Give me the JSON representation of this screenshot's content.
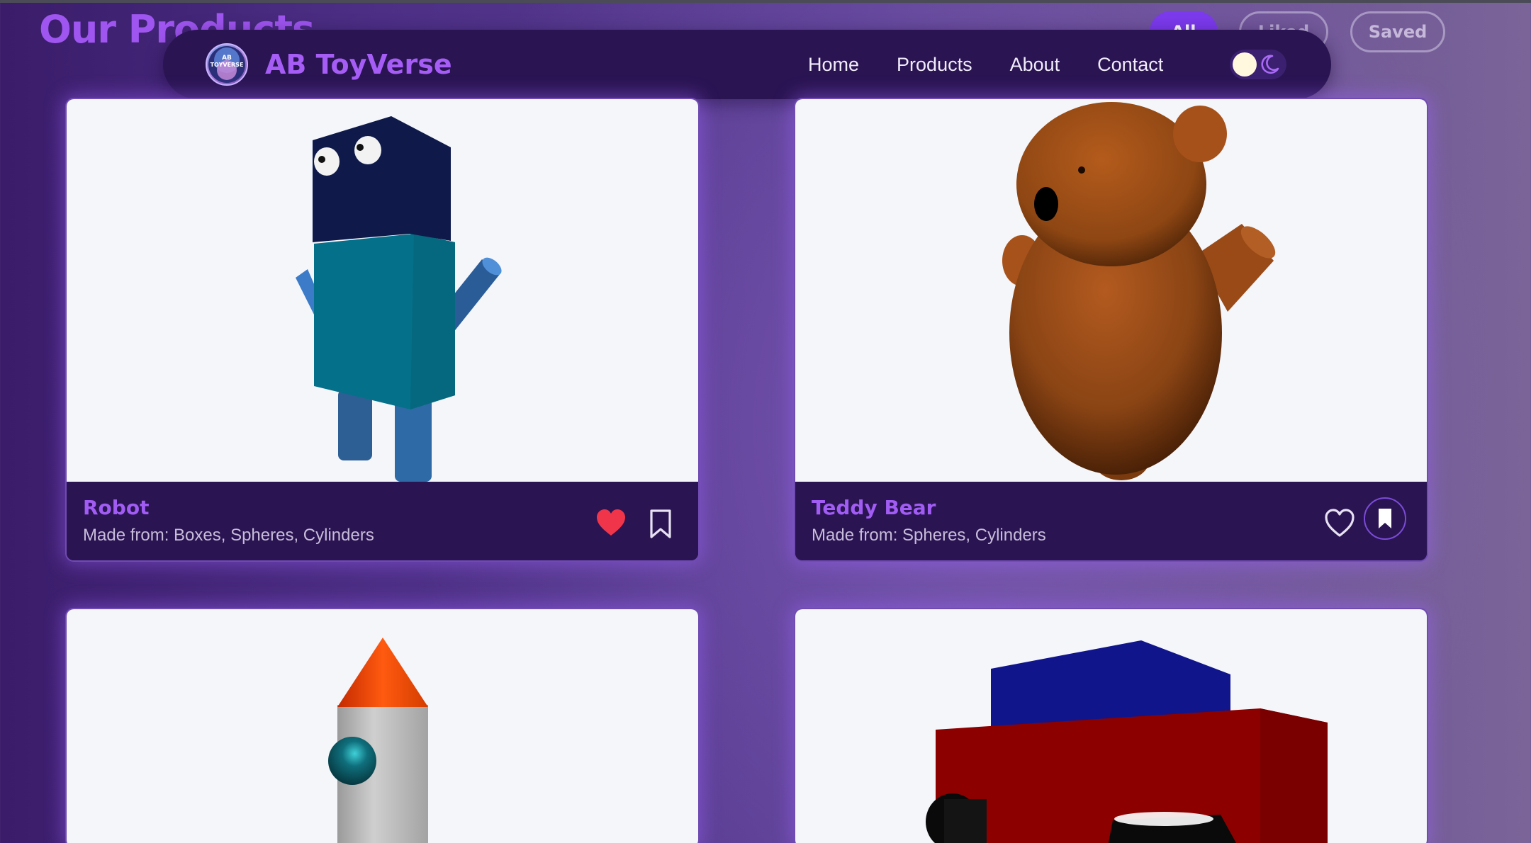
{
  "page": {
    "title": "Our Products",
    "filters": [
      {
        "label": "All",
        "active": true
      },
      {
        "label": "Liked",
        "active": false
      },
      {
        "label": "Saved",
        "active": false
      }
    ]
  },
  "navbar": {
    "brand": "AB ToyVerse",
    "logo_text": "AB TOYVERSE",
    "links": [
      "Home",
      "Products",
      "About",
      "Contact"
    ],
    "theme_toggle_icon": "moon-icon"
  },
  "products": [
    {
      "name": "Robot",
      "materials": "Made from: Boxes, Spheres, Cylinders",
      "liked": true,
      "saved": false
    },
    {
      "name": "Teddy Bear",
      "materials": "Made from: Spheres, Cylinders",
      "liked": false,
      "saved": true
    },
    {
      "name": "",
      "materials": "",
      "liked": false,
      "saved": false
    },
    {
      "name": "",
      "materials": "",
      "liked": false,
      "saved": false
    }
  ],
  "colors": {
    "accent": "#a15cf4",
    "navbar_bg": "#2a1452",
    "like_active": "#f0354a",
    "filter_active": "#7c3aed"
  }
}
